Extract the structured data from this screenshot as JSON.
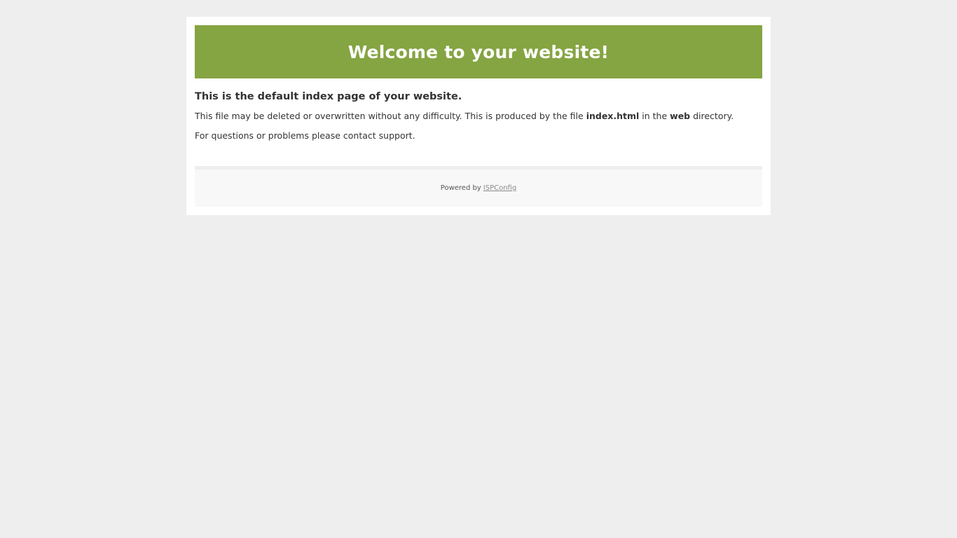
{
  "header": {
    "title": "Welcome to your website!",
    "color": "#85a442"
  },
  "content": {
    "heading": "This is the default index page of your website.",
    "paragraph1": {
      "part1": "This file may be deleted or overwritten without any difficulty. This is produced by the file ",
      "file_name": "index.html",
      "part2": " in the ",
      "directory": "web",
      "part3": " directory."
    },
    "paragraph2": "For questions or problems please contact support."
  },
  "footer": {
    "powered_by": "Powered by",
    "link_text": "ISPConfig"
  }
}
